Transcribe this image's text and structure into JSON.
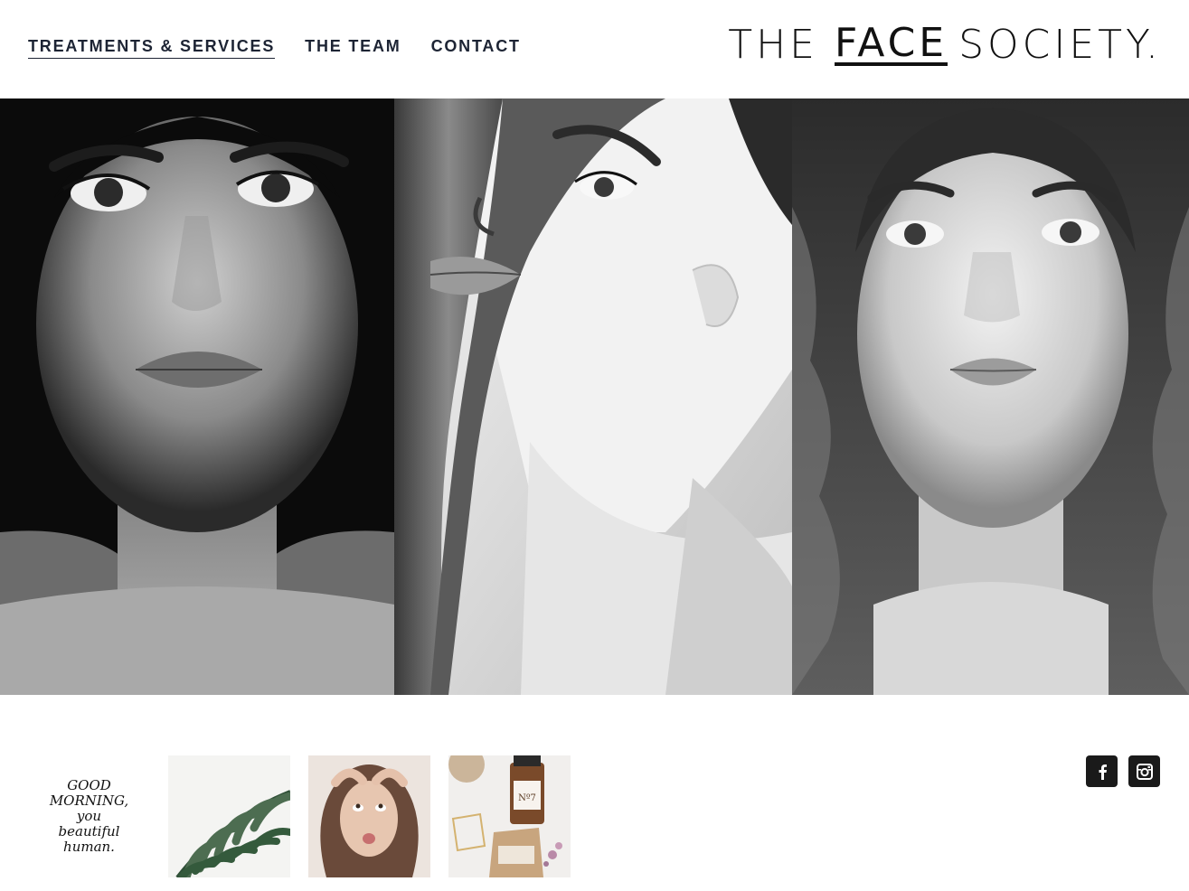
{
  "nav": {
    "items": [
      {
        "label": "TREATMENTS & SERVICES",
        "active": true
      },
      {
        "label": "THE TEAM",
        "active": false
      },
      {
        "label": "CONTACT",
        "active": false
      }
    ]
  },
  "logo": {
    "part1": "THE",
    "part2": "FACE",
    "part3": "SOCIETY."
  },
  "hero": {
    "panels": [
      "portrait-dark-background",
      "portrait-hair-over-eye",
      "portrait-wavy-hair"
    ]
  },
  "thumbnails": {
    "quote_lines": [
      "GOOD",
      "MORNING,",
      "you",
      "beautiful",
      "human."
    ],
    "items": [
      "quote-card",
      "palm-leaf",
      "face-massage",
      "skincare-products"
    ],
    "product_label": "Nº7"
  },
  "social": {
    "icons": [
      "facebook-icon",
      "instagram-icon"
    ],
    "color": "#1a1a1a"
  },
  "colors": {
    "nav_text": "#1d2434",
    "background": "#ffffff"
  }
}
